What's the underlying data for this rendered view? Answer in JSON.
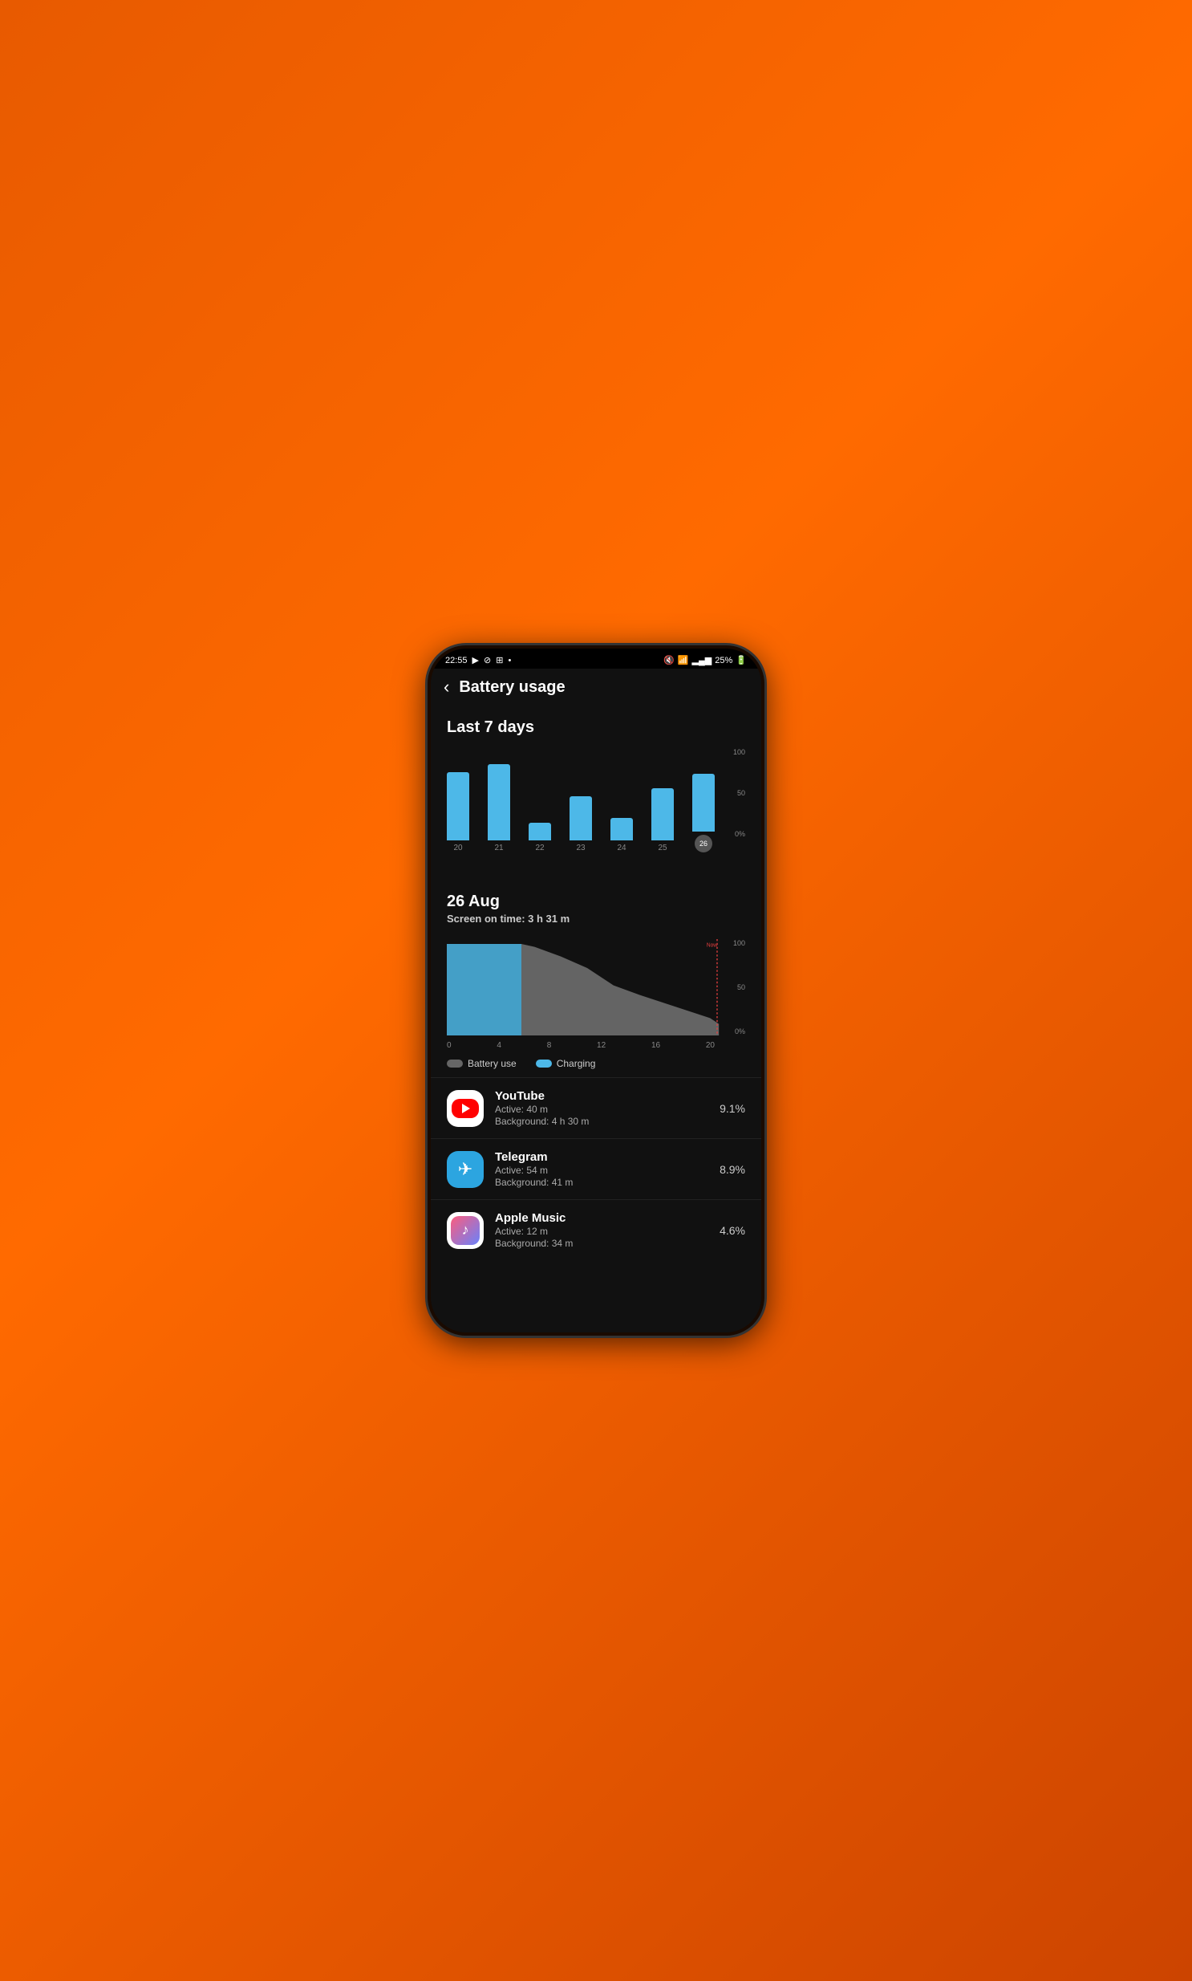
{
  "status_bar": {
    "time": "22:55",
    "battery_percent": "25%",
    "icons_left": [
      "▶",
      "⊘",
      "⊞",
      "•"
    ],
    "wifi_signal": "wifi",
    "mute": "🔇"
  },
  "header": {
    "back_label": "‹",
    "title": "Battery usage"
  },
  "weekly_chart": {
    "title": "Last 7 days",
    "y_labels": [
      "100",
      "50",
      "0%"
    ],
    "bars": [
      {
        "day": "20",
        "height": 85
      },
      {
        "day": "21",
        "height": 95
      },
      {
        "day": "22",
        "height": 22
      },
      {
        "day": "23",
        "height": 55
      },
      {
        "day": "24",
        "height": 28
      },
      {
        "day": "25",
        "height": 65
      },
      {
        "day": "26",
        "height": 72,
        "active": true
      }
    ]
  },
  "daily_detail": {
    "date": "26 Aug",
    "screen_on_time_label": "Screen on time:",
    "screen_on_time_value": "3 h 31 m"
  },
  "area_chart": {
    "x_labels": [
      "0",
      "4",
      "8",
      "12",
      "16",
      "20"
    ],
    "y_labels": [
      "100",
      "50",
      "0%"
    ],
    "now_label": "Now"
  },
  "legend": {
    "battery_use": "Battery use",
    "charging": "Charging"
  },
  "apps": [
    {
      "name": "YouTube",
      "icon_type": "youtube",
      "active": "Active: 40 m",
      "background": "Background: 4 h 30 m",
      "percent": "9.1%"
    },
    {
      "name": "Telegram",
      "icon_type": "telegram",
      "active": "Active: 54 m",
      "background": "Background: 41 m",
      "percent": "8.9%"
    },
    {
      "name": "Apple Music",
      "icon_type": "apple_music",
      "active": "Active: 12 m",
      "background": "Background: 34 m",
      "percent": "4.6%"
    }
  ]
}
